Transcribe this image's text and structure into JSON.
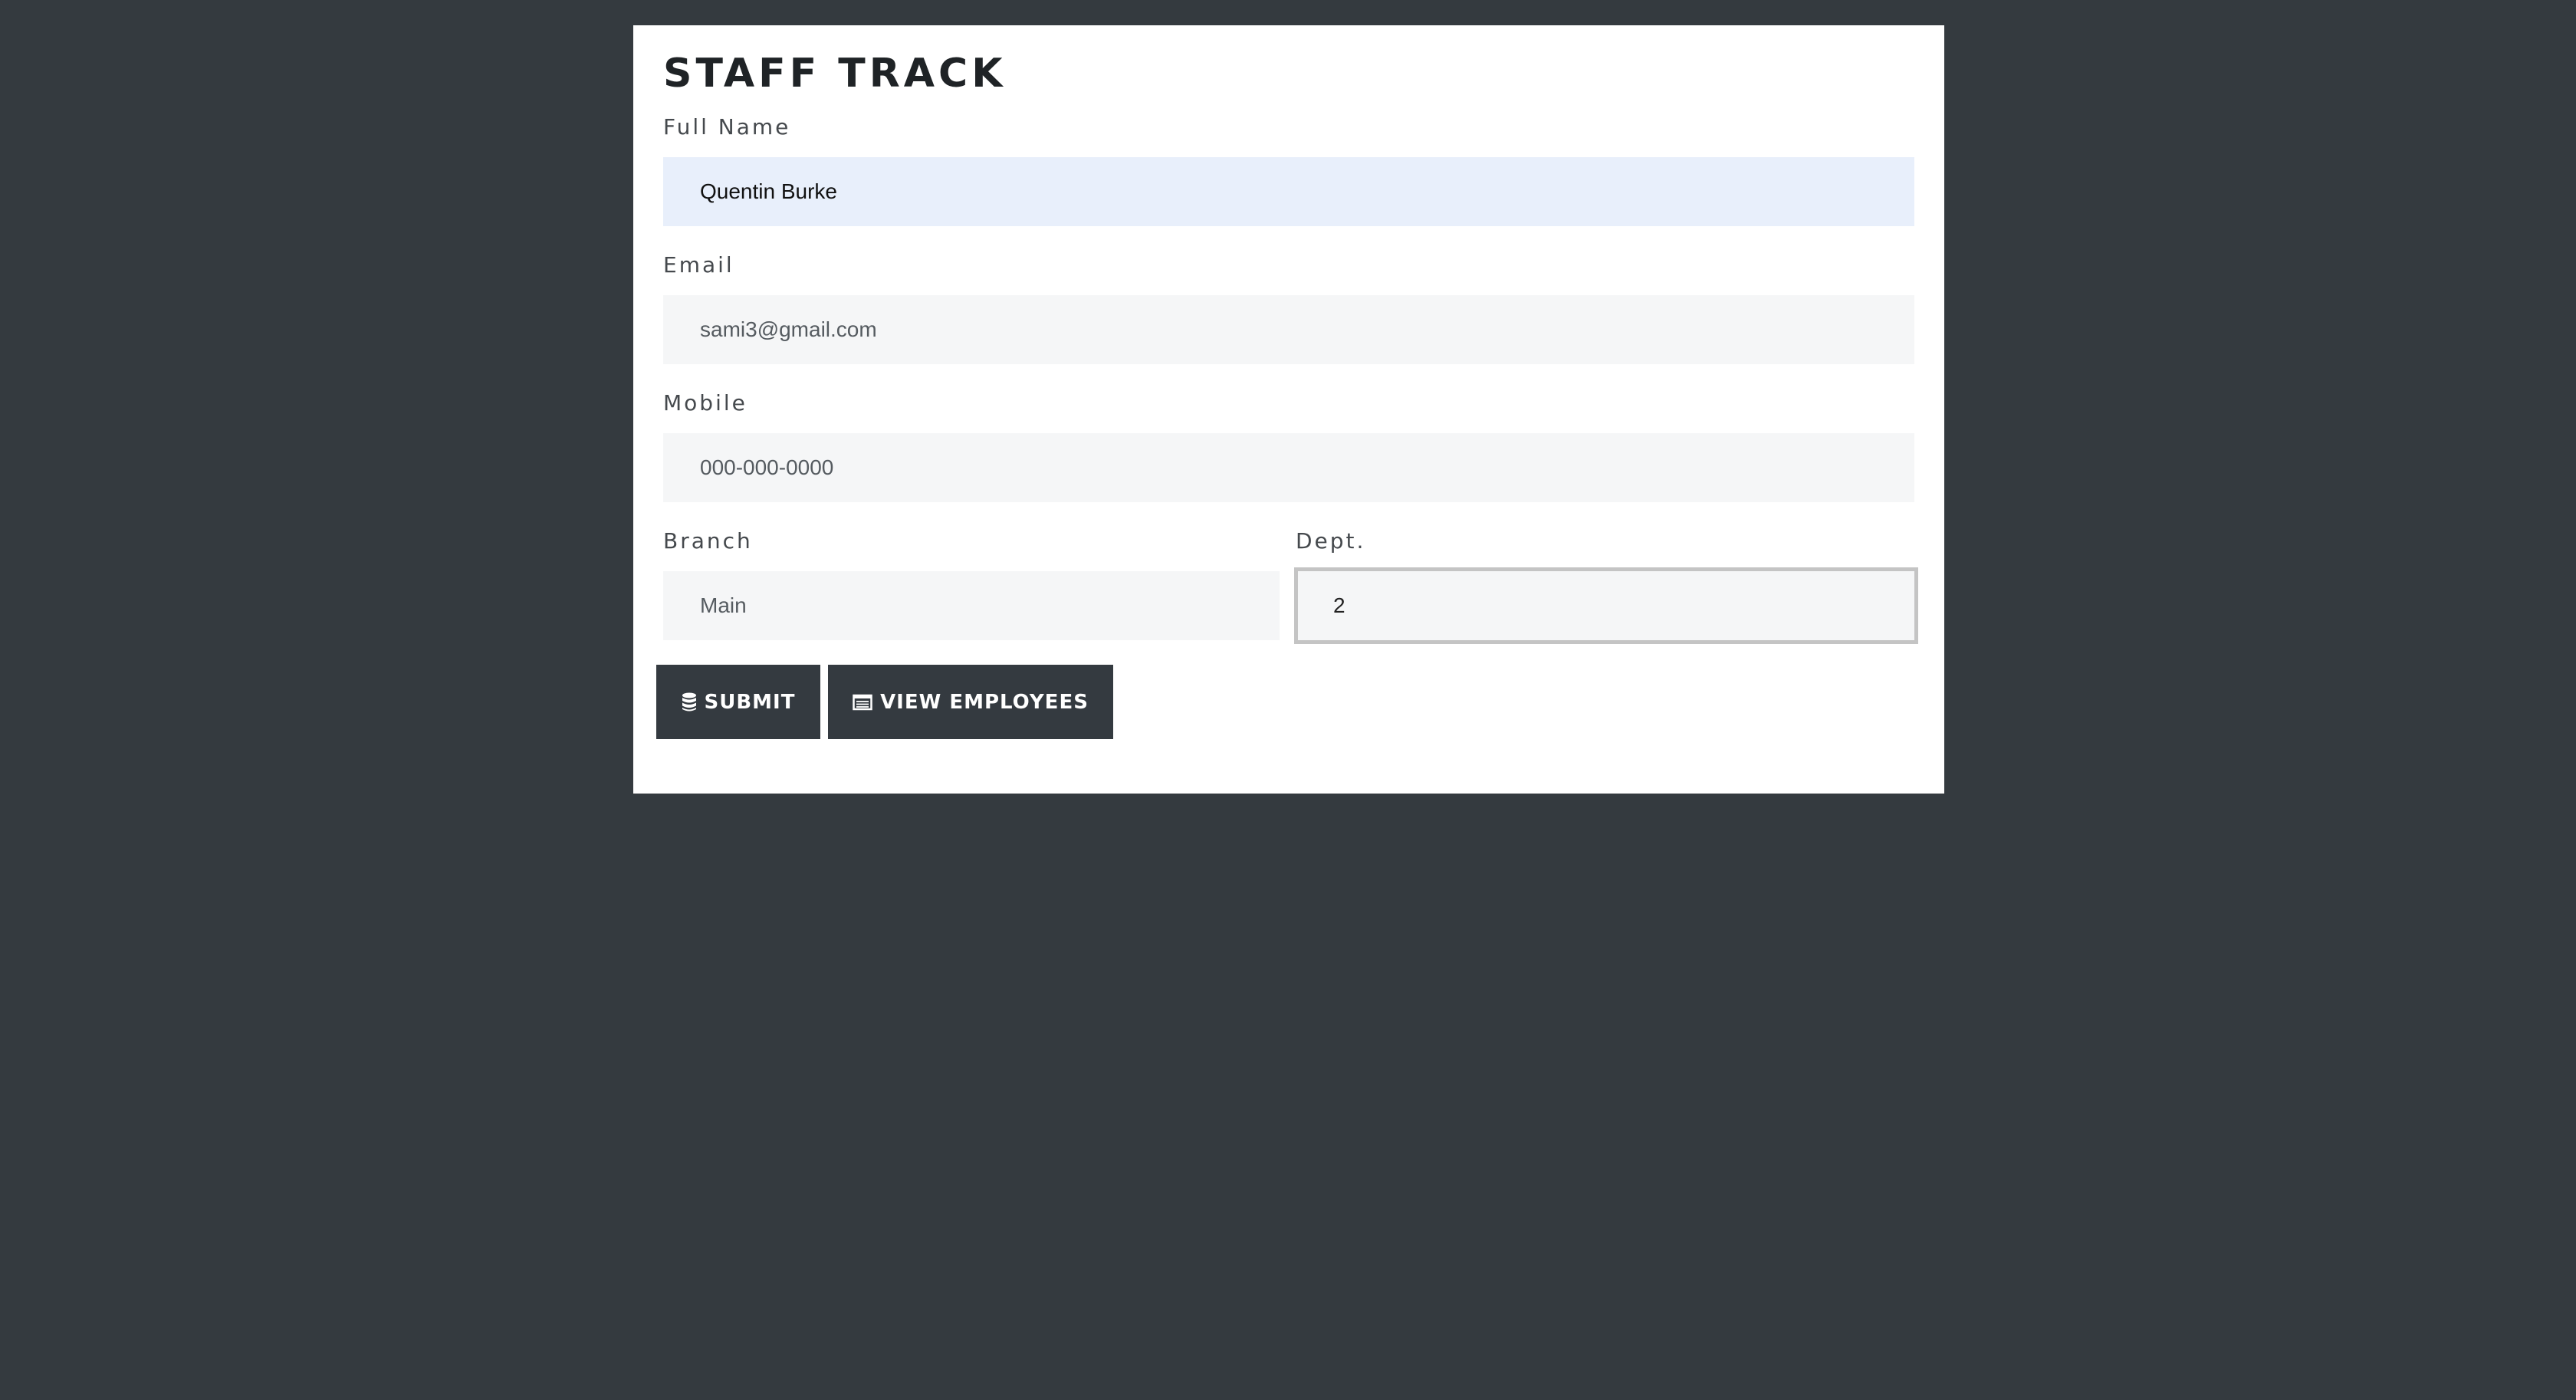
{
  "app": {
    "title": "STAFF TRACK"
  },
  "form": {
    "full_name": {
      "label": "Full Name",
      "value": "Quentin Burke"
    },
    "email": {
      "label": "Email",
      "value": "sami3@gmail.com"
    },
    "mobile": {
      "label": "Mobile",
      "value": "000-000-0000"
    },
    "branch": {
      "label": "Branch",
      "value": "Main"
    },
    "dept": {
      "label": "Dept.",
      "value": "2"
    }
  },
  "buttons": {
    "submit": {
      "label": "SUBMIT",
      "icon": "database-icon"
    },
    "view_employees": {
      "label": "VIEW EMPLOYEES",
      "icon": "table-icon"
    }
  },
  "colors": {
    "background": "#343a3f",
    "card": "#ffffff",
    "button": "#343a40",
    "autofill": "#e8effb",
    "input": "#f5f6f7"
  }
}
